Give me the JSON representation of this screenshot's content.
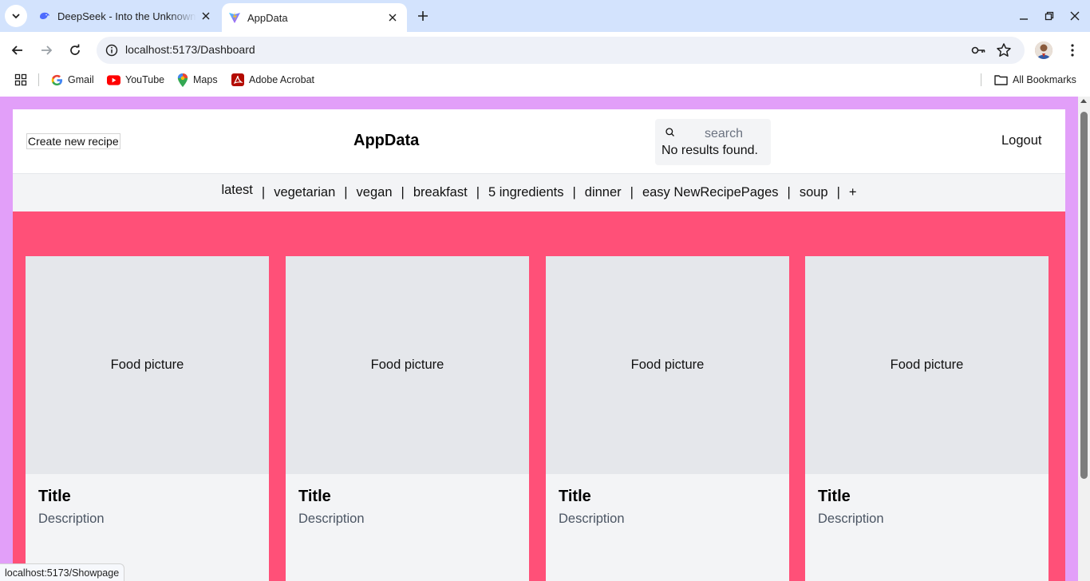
{
  "browser": {
    "tabs": [
      {
        "title": "DeepSeek - Into the Unknown",
        "active": false,
        "favicon": "deepseek-whale-icon"
      },
      {
        "title": "AppData",
        "active": true,
        "favicon": "vite-icon"
      }
    ],
    "url": "localhost:5173/Dashboard",
    "bookmarks": [
      {
        "label": "Gmail",
        "icon": "google-icon"
      },
      {
        "label": "YouTube",
        "icon": "youtube-icon"
      },
      {
        "label": "Maps",
        "icon": "maps-icon"
      },
      {
        "label": "Adobe Acrobat",
        "icon": "acrobat-icon"
      }
    ],
    "all_bookmarks_label": "All Bookmarks",
    "status_url": "localhost:5173/Showpage"
  },
  "app": {
    "create_button": "Create new recipe",
    "brand": "AppData",
    "search": {
      "placeholder": "search",
      "no_results": "No results found."
    },
    "logout": "Logout",
    "categories": [
      "latest",
      "vegetarian",
      "vegan",
      "breakfast",
      "5 ingredients",
      "dinner",
      "easy NewRecipePages",
      "soup",
      "+"
    ],
    "separator": "|",
    "cards": [
      {
        "picture": "Food picture",
        "title": "Title",
        "description": "Description"
      },
      {
        "picture": "Food picture",
        "title": "Title",
        "description": "Description"
      },
      {
        "picture": "Food picture",
        "title": "Title",
        "description": "Description"
      },
      {
        "picture": "Food picture",
        "title": "Title",
        "description": "Description"
      }
    ]
  },
  "colors": {
    "page_background": "#e29ff9",
    "app_background": "#ff5078",
    "card_background": "#f3f4f6",
    "picture_background": "#e5e7eb",
    "tabstrip": "#d3e3fd"
  }
}
